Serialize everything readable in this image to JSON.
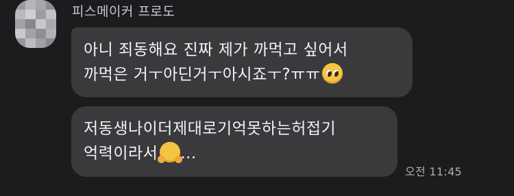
{
  "sender": {
    "name": "피스메이커 프로도"
  },
  "messages": [
    {
      "lines": [
        "아니 죄동해요 진짜 제가 까먹고 싶어서",
        "까먹은 거ㅜ아딘거ㅜ아시죠ㅜ?ㅠㅠ"
      ],
      "emoji": "pleading-face-icon"
    },
    {
      "lines": [
        "저동생나이더제대로기억못하는허접기",
        "억력이라서"
      ],
      "emoji": "hugging-face-icon",
      "trailing": "..."
    }
  ],
  "timestamp": "오전 11:45",
  "colors": {
    "background": "#1c1c1e",
    "bubble": "#3a3a3c",
    "text": "#f2f2f7",
    "meta": "#aeaeb2"
  }
}
